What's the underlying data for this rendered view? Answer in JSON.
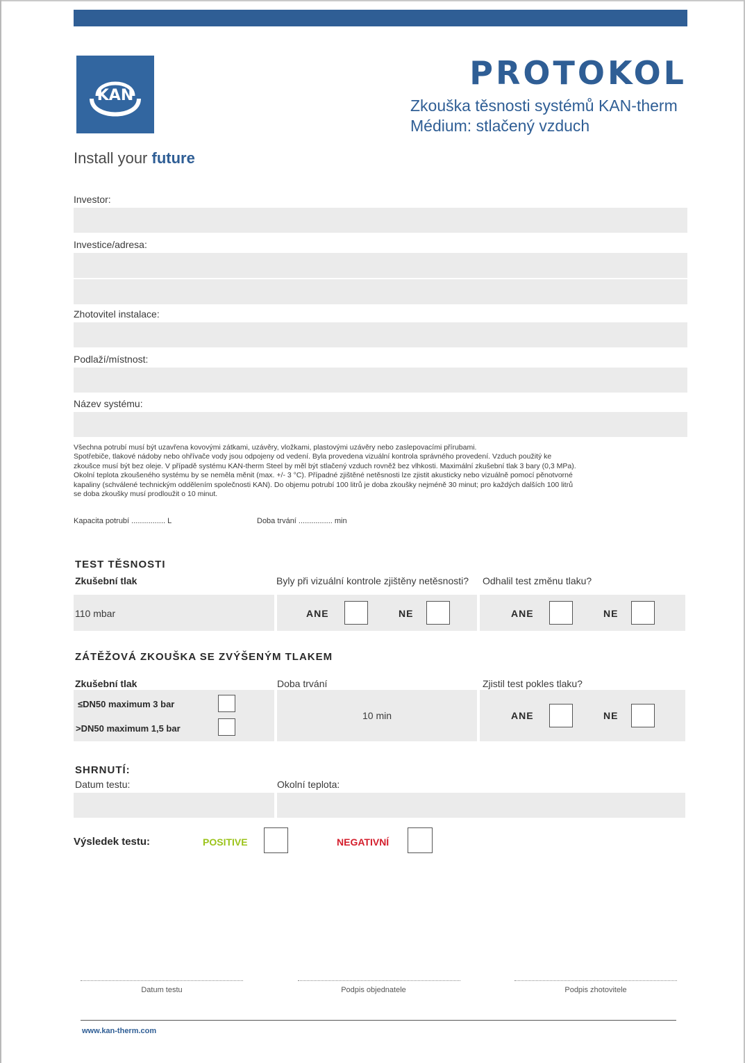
{
  "header": {
    "title": "PROTOKOL",
    "subtitle_1": "Zkouška těsnosti systémů KAN-therm",
    "subtitle_2": "Médium: stlačený vzduch",
    "logo_text": "KAN",
    "tagline_prefix": "Install your",
    "tagline_highlight": "future",
    "brand_color": "#2f5e95"
  },
  "fields": {
    "investor": "Investor:",
    "investice": "Investice/adresa:",
    "zhotovitel": "Zhotovitel instalace:",
    "podlazi": "Podlaží/místnost:",
    "system": "Název systému:"
  },
  "notice": {
    "l1": "Všechna potrubí musí být uzavřena kovovými zátkami, uzávěry, vložkami, plastovými uzávěry nebo zaslepovacími přírubami.",
    "l2": "Spotřebiče, tlakové nádoby nebo ohřívače vody jsou odpojeny od vedení. Byla provedena vizuální kontrola správného provedení. Vzduch použitý ke",
    "l3": "zkoušce musí být bez oleje. V případě systému KAN-therm Steel by měl být stlačený vzduch rovněž bez vlhkosti. Maximální zkušební tlak 3 bary (0,3 MPa).",
    "l4": "Okolní teplota zkoušeného systému by se neměla měnit (max. +/- 3 °C). Případné zjištěné netěsnosti lze zjistit akusticky nebo vizuálně pomocí pěnotvorné",
    "l5": "kapaliny (schválené technickým oddělením společnosti KAN). Do objemu potrubí 100 litrů je doba zkoušky nejméně 30 minut; pro každých dalších 100 litrů",
    "l6": "se doba zkoušky musí prodloužit o 10 minut."
  },
  "capacity": {
    "kapacita": "Kapacita potrubí ................ L",
    "doba": "Doba trvání ................ min"
  },
  "test_tesnosti": {
    "heading": "TEST TĚSNOSTI",
    "col_pressure": "Zkušební tlak",
    "col_visual": "Byly při vizuální kontrole zjištěny netěsnosti?",
    "col_change": "Odhalil test změnu tlaku?",
    "pressure_value": "110 mbar",
    "yes": "ANE",
    "no": "NE"
  },
  "zatezova": {
    "heading": "ZÁTĚŽOVÁ ZKOUŠKA SE ZVÝŠENÝM TLAKEM",
    "col_pressure": "Zkušební tlak",
    "col_duration": "Doba trvání",
    "col_drop": "Zjistil test pokles tlaku?",
    "opt_1": "≤DN50 maximum 3 bar",
    "opt_2": ">DN50 maximum 1,5 bar",
    "duration_value": "10 min",
    "yes": "ANE",
    "no": "NE"
  },
  "shrnuti": {
    "heading": "SHRNUTÍ:",
    "date_label": "Datum testu:",
    "temp_label": "Okolní teplota:",
    "result_label": "Výsledek testu:",
    "positive": "POSITIVE",
    "negative": "NEGATIVNÍ",
    "positive_color": "#9bc31a",
    "negative_color": "#d41e2c"
  },
  "signatures": {
    "date": "Datum testu",
    "client": "Podpis objednatele",
    "contractor": "Podpis zhotovitele"
  },
  "footer": {
    "url": "www.kan-therm.com"
  }
}
